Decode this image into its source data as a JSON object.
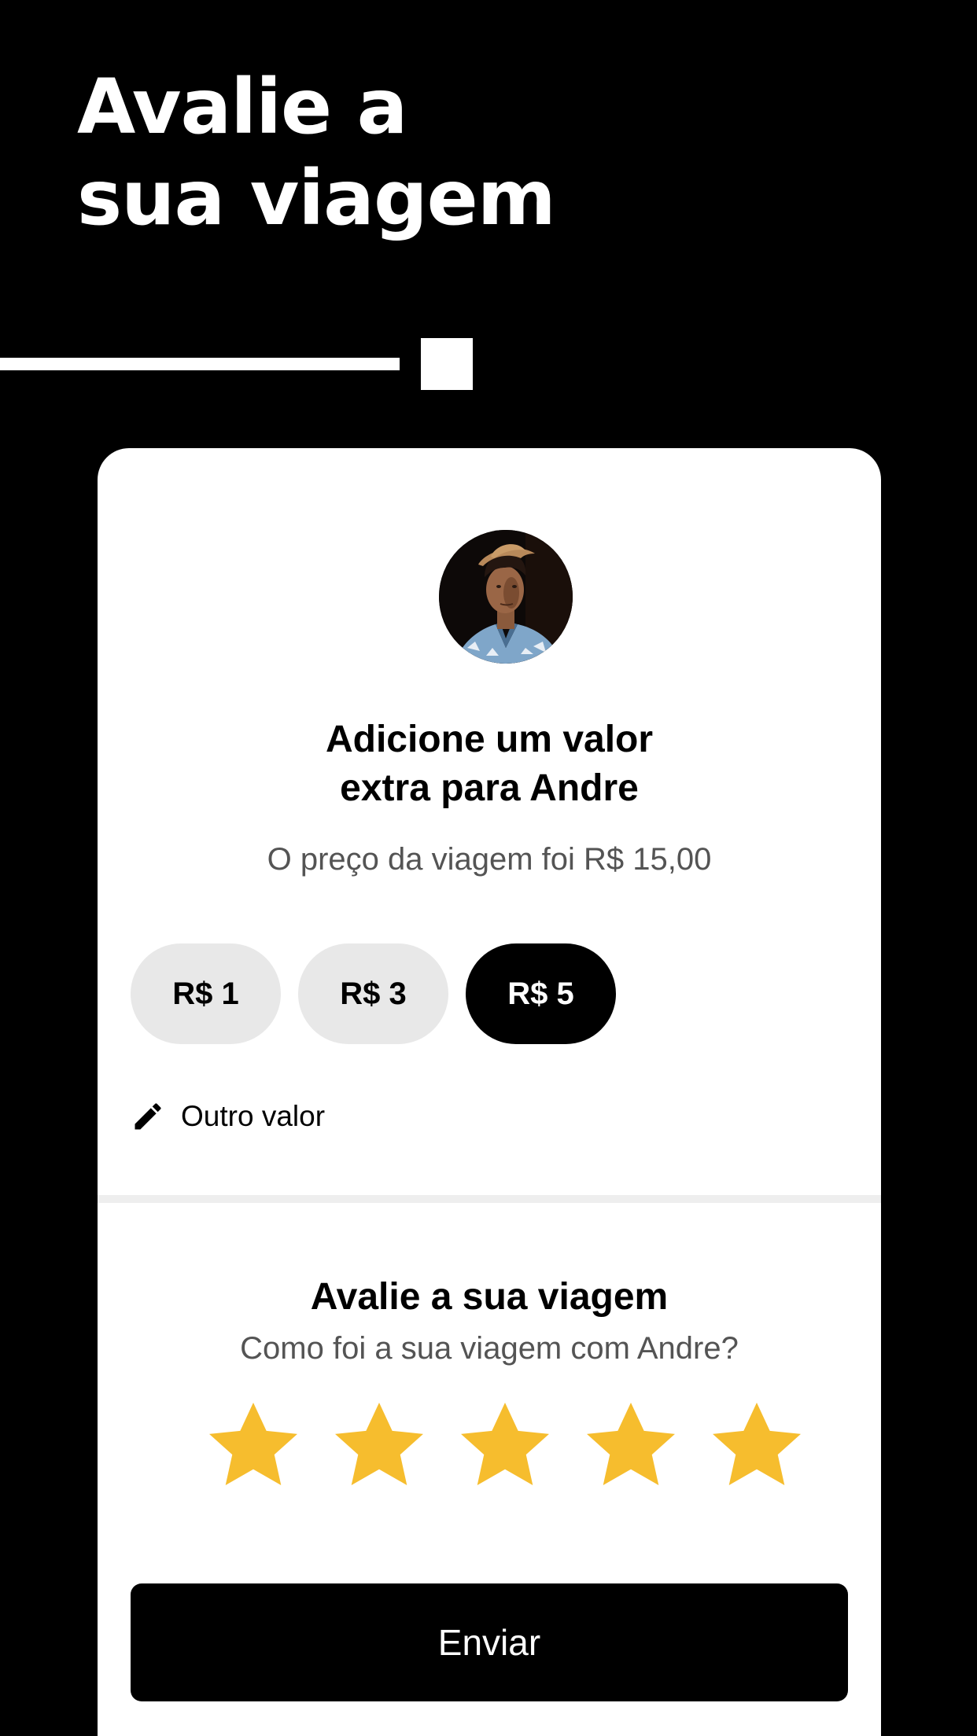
{
  "header": {
    "title_line1": "Avalie a",
    "title_line2": "sua viagem"
  },
  "tip": {
    "title_line1": "Adicione um valor",
    "title_line2": "extra para Andre",
    "subtitle": "O preço da viagem foi R$ 15,00",
    "options": [
      {
        "label": "R$ 1",
        "selected": false
      },
      {
        "label": "R$ 3",
        "selected": false
      },
      {
        "label": "R$ 5",
        "selected": true
      }
    ],
    "custom_label": "Outro valor"
  },
  "rating": {
    "title": "Avalie a sua viagem",
    "subtitle": "Como foi a sua viagem com Andre?",
    "stars_total": 5,
    "stars_filled": 5,
    "star_color": "#F6BD2E"
  },
  "submit": {
    "label": "Enviar"
  },
  "colors": {
    "background": "#000000",
    "card": "#FFFFFF",
    "pill_default": "#E8E8E8",
    "pill_selected": "#000000",
    "subtitle_text": "#545454"
  },
  "icons": {
    "custom_amount": "pencil-icon",
    "driver": "driver-avatar",
    "star": "star-icon"
  }
}
